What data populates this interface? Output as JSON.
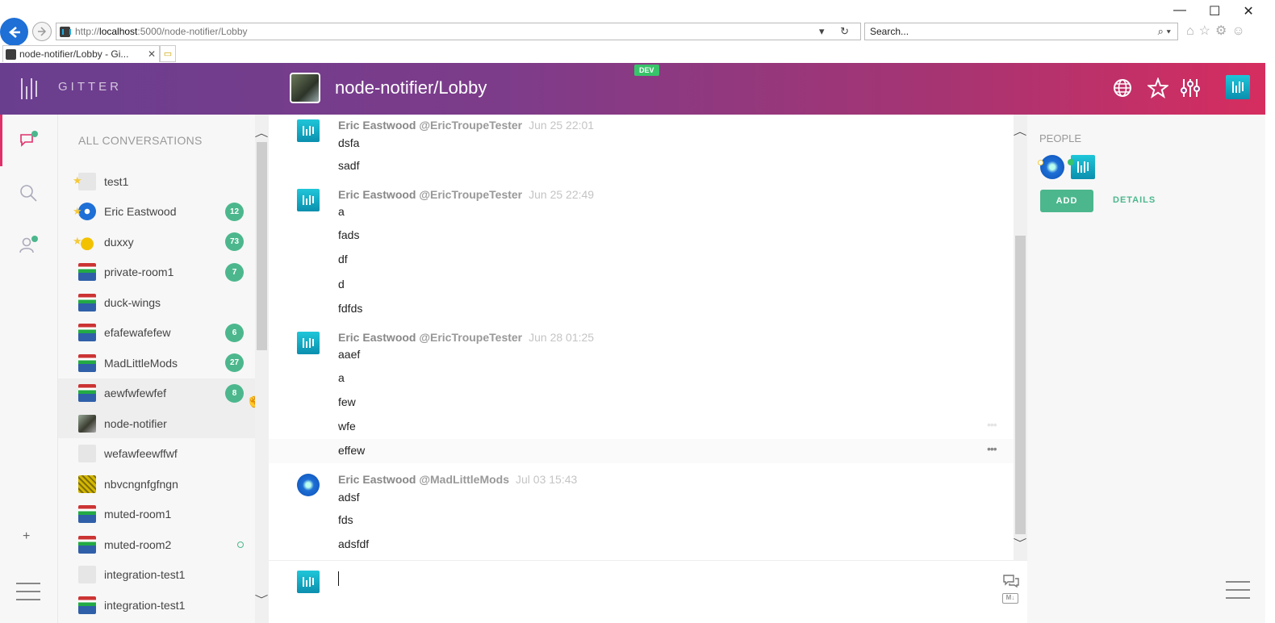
{
  "browser": {
    "url_prefix": "http://",
    "url_host": "localhost",
    "url_rest": ":5000/node-notifier/Lobby",
    "search_placeholder": "Search...",
    "tab_title": "node-notifier/Lobby - Gi...",
    "addr_controls": "▾ ↻",
    "search_controls": "⌕ ▾",
    "toolbar_icons": "⌂☆⚙☺",
    "win_min": "—",
    "win_max": "☐",
    "win_close": "✕",
    "tab_close": "✕"
  },
  "header": {
    "logo": "GITTER",
    "dev_badge": "DEV",
    "room_title": "node-notifier/Lobby"
  },
  "rail": {
    "plus": "+"
  },
  "conversations": {
    "heading": "ALL CONVERSATIONS",
    "items": [
      {
        "name": "test1",
        "badge": "",
        "avatar": "grey",
        "fav": true
      },
      {
        "name": "Eric Eastwood",
        "badge": "12",
        "avatar": "blue",
        "fav": true
      },
      {
        "name": "duxxy",
        "badge": "73",
        "avatar": "duck",
        "fav": true
      },
      {
        "name": "private-room1",
        "badge": "7",
        "avatar": "flag"
      },
      {
        "name": "duck-wings",
        "badge": "",
        "avatar": "flag"
      },
      {
        "name": "efafewafefew",
        "badge": "6",
        "avatar": "flag"
      },
      {
        "name": "MadLittleMods",
        "badge": "27",
        "avatar": "flag"
      },
      {
        "name": "aewfwfewfef",
        "badge": "8",
        "avatar": "flag"
      },
      {
        "name": "node-notifier",
        "badge": "",
        "avatar": "node"
      },
      {
        "name": "wefawfeewffwf",
        "badge": "",
        "avatar": "grey"
      },
      {
        "name": "nbvcngnfgfngn",
        "badge": "",
        "avatar": "yellow"
      },
      {
        "name": "muted-room1",
        "badge": "",
        "avatar": "flag"
      },
      {
        "name": "muted-room2",
        "badge": "",
        "avatar": "flag",
        "activity": true
      },
      {
        "name": "integration-test1",
        "badge": "",
        "avatar": "grey"
      },
      {
        "name": "integration-test1",
        "badge": "",
        "avatar": "flag"
      }
    ]
  },
  "messages": [
    {
      "author": "Eric Eastwood",
      "username": "@EricTroupeTester",
      "time": "Jun 25 22:01",
      "lines": [
        "dsfa",
        "sadf"
      ]
    },
    {
      "author": "Eric Eastwood",
      "username": "@EricTroupeTester",
      "time": "Jun 25 22:49",
      "lines": [
        "a",
        "fads",
        "df",
        "d",
        "fdfds"
      ]
    },
    {
      "author": "Eric Eastwood",
      "username": "@EricTroupeTester",
      "time": "Jun 28 01:25",
      "lines": [
        "aaef",
        "a",
        "few",
        "wfe",
        "effew"
      ]
    },
    {
      "author": "Eric Eastwood",
      "username": "@MadLittleMods",
      "time": "Jul 03 15:43",
      "lines": [
        "adsf",
        "fds",
        "adsfdf"
      ]
    }
  ],
  "chat_input": {
    "value": ""
  },
  "people": {
    "heading": "PEOPLE",
    "add_label": "ADD",
    "details_label": "DETAILS"
  },
  "colors": {
    "accent": "#4cb78d",
    "header_start": "#6a3e8f",
    "header_end": "#d62d5f",
    "active": "#e0306a"
  }
}
